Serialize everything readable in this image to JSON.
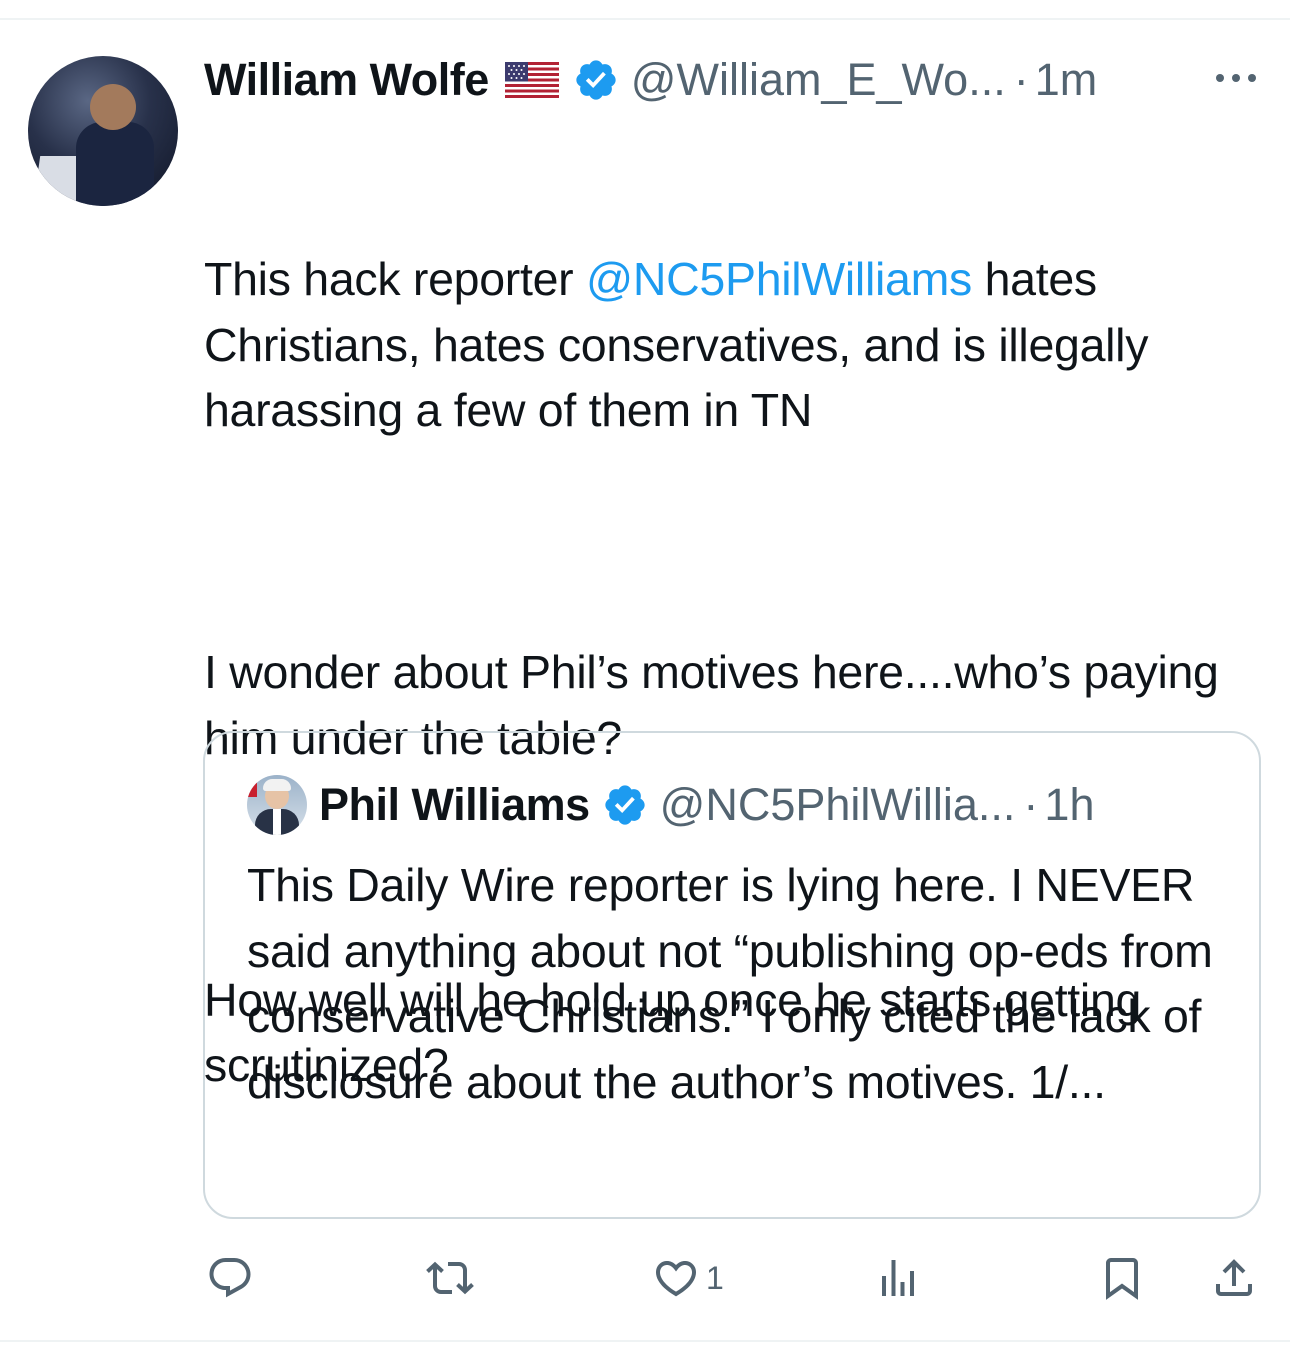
{
  "tweet": {
    "author_name": "William Wolfe",
    "author_handle": "@William_E_Wo...",
    "timestamp": "1m",
    "separator": "·",
    "flag_icon": "us-flag-icon",
    "verified": true,
    "text_before_mention": "This hack reporter ",
    "mention": "@NC5PhilWilliams",
    "text_after_mention": " hates Christians, hates conservatives, and is illegally harassing a few of them in TN",
    "paragraph_2": "I wonder about Phil’s motives here....who’s paying him under the table?",
    "paragraph_3": "How well will he hold up once he starts getting scrutinized?"
  },
  "quoted_tweet": {
    "author_name": "Phil Williams",
    "author_handle": "@NC5PhilWillia...",
    "timestamp": "1h",
    "separator": "·",
    "verified": true,
    "text": "This Daily Wire reporter is lying here. I NEVER said anything about not “publishing op-eds from  conservative Christians.” I only cited the lack of disclosure about the author’s motives. 1/..."
  },
  "actions": {
    "reply_count": "",
    "repost_count": "",
    "like_count": "1",
    "views_count": ""
  },
  "colors": {
    "accent": "#1d9bf0",
    "secondary_text": "#536471",
    "border": "#cfd9de",
    "primary_text": "#0f1419"
  }
}
